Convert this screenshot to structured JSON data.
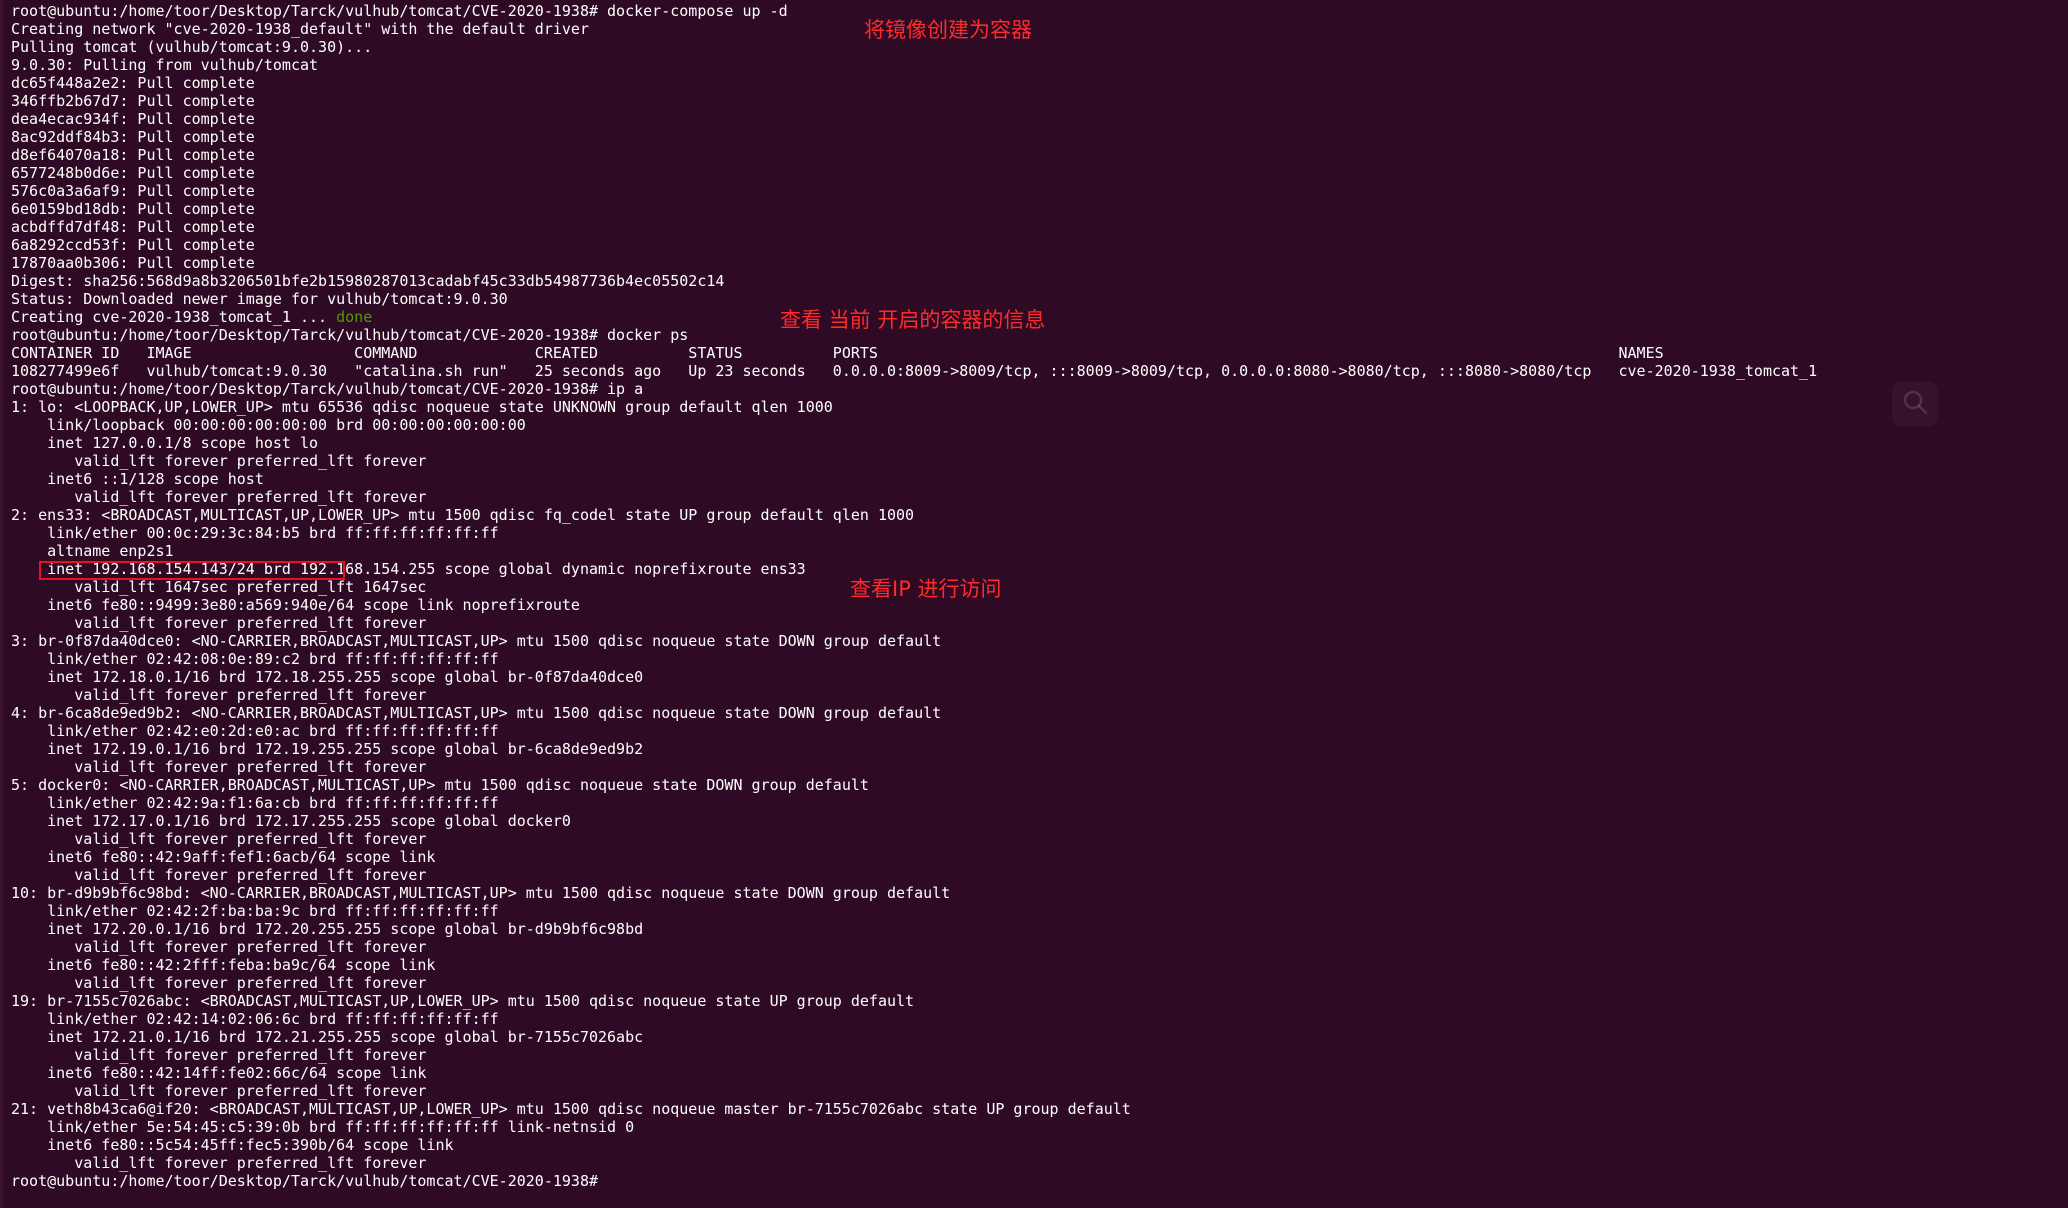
{
  "terminal": {
    "lines": [
      "root@ubuntu:/home/toor/Desktop/Tarck/vulhub/tomcat/CVE-2020-1938# docker-compose up -d",
      "Creating network \"cve-2020-1938_default\" with the default driver",
      "Pulling tomcat (vulhub/tomcat:9.0.30)...",
      "9.0.30: Pulling from vulhub/tomcat",
      "dc65f448a2e2: Pull complete",
      "346ffb2b67d7: Pull complete",
      "dea4ecac934f: Pull complete",
      "8ac92ddf84b3: Pull complete",
      "d8ef64070a18: Pull complete",
      "6577248b0d6e: Pull complete",
      "576c0a3a6af9: Pull complete",
      "6e0159bd18db: Pull complete",
      "acbdffd7df48: Pull complete",
      "6a8292ccd53f: Pull complete",
      "17870aa0b306: Pull complete",
      "Digest: sha256:568d9a8b3206501bfe2b15980287013cadabf45c33db54987736b4ec05502c14",
      "Status: Downloaded newer image for vulhub/tomcat:9.0.30",
      "Creating cve-2020-1938_tomcat_1 ... ",
      "root@ubuntu:/home/toor/Desktop/Tarck/vulhub/tomcat/CVE-2020-1938# docker ps",
      "CONTAINER ID   IMAGE                  COMMAND             CREATED          STATUS          PORTS                                                                                  NAMES",
      "108277499e6f   vulhub/tomcat:9.0.30   \"catalina.sh run\"   25 seconds ago   Up 23 seconds   0.0.0.0:8009->8009/tcp, :::8009->8009/tcp, 0.0.0.0:8080->8080/tcp, :::8080->8080/tcp   cve-2020-1938_tomcat_1",
      "root@ubuntu:/home/toor/Desktop/Tarck/vulhub/tomcat/CVE-2020-1938# ip a",
      "1: lo: <LOOPBACK,UP,LOWER_UP> mtu 65536 qdisc noqueue state UNKNOWN group default qlen 1000",
      "    link/loopback 00:00:00:00:00:00 brd 00:00:00:00:00:00",
      "    inet 127.0.0.1/8 scope host lo",
      "       valid_lft forever preferred_lft forever",
      "    inet6 ::1/128 scope host",
      "       valid_lft forever preferred_lft forever",
      "2: ens33: <BROADCAST,MULTICAST,UP,LOWER_UP> mtu 1500 qdisc fq_codel state UP group default qlen 1000",
      "    link/ether 00:0c:29:3c:84:b5 brd ff:ff:ff:ff:ff:ff",
      "    altname enp2s1",
      "    inet 192.168.154.143/24 brd 192.168.154.255 scope global dynamic noprefixroute ens33",
      "       valid_lft 1647sec preferred_lft 1647sec",
      "    inet6 fe80::9499:3e80:a569:940e/64 scope link noprefixroute",
      "       valid_lft forever preferred_lft forever",
      "3: br-0f87da40dce0: <NO-CARRIER,BROADCAST,MULTICAST,UP> mtu 1500 qdisc noqueue state DOWN group default",
      "    link/ether 02:42:08:0e:89:c2 brd ff:ff:ff:ff:ff:ff",
      "    inet 172.18.0.1/16 brd 172.18.255.255 scope global br-0f87da40dce0",
      "       valid_lft forever preferred_lft forever",
      "4: br-6ca8de9ed9b2: <NO-CARRIER,BROADCAST,MULTICAST,UP> mtu 1500 qdisc noqueue state DOWN group default",
      "    link/ether 02:42:e0:2d:e0:ac brd ff:ff:ff:ff:ff:ff",
      "    inet 172.19.0.1/16 brd 172.19.255.255 scope global br-6ca8de9ed9b2",
      "       valid_lft forever preferred_lft forever",
      "5: docker0: <NO-CARRIER,BROADCAST,MULTICAST,UP> mtu 1500 qdisc noqueue state DOWN group default",
      "    link/ether 02:42:9a:f1:6a:cb brd ff:ff:ff:ff:ff:ff",
      "    inet 172.17.0.1/16 brd 172.17.255.255 scope global docker0",
      "       valid_lft forever preferred_lft forever",
      "    inet6 fe80::42:9aff:fef1:6acb/64 scope link",
      "       valid_lft forever preferred_lft forever",
      "10: br-d9b9bf6c98bd: <NO-CARRIER,BROADCAST,MULTICAST,UP> mtu 1500 qdisc noqueue state DOWN group default",
      "    link/ether 02:42:2f:ba:ba:9c brd ff:ff:ff:ff:ff:ff",
      "    inet 172.20.0.1/16 brd 172.20.255.255 scope global br-d9b9bf6c98bd",
      "       valid_lft forever preferred_lft forever",
      "    inet6 fe80::42:2fff:feba:ba9c/64 scope link",
      "       valid_lft forever preferred_lft forever",
      "19: br-7155c7026abc: <BROADCAST,MULTICAST,UP,LOWER_UP> mtu 1500 qdisc noqueue state UP group default",
      "    link/ether 02:42:14:02:06:6c brd ff:ff:ff:ff:ff:ff",
      "    inet 172.21.0.1/16 brd 172.21.255.255 scope global br-7155c7026abc",
      "       valid_lft forever preferred_lft forever",
      "    inet6 fe80::42:14ff:fe02:66c/64 scope link",
      "       valid_lft forever preferred_lft forever",
      "21: veth8b43ca6@if20: <BROADCAST,MULTICAST,UP,LOWER_UP> mtu 1500 qdisc noqueue master br-7155c7026abc state UP group default",
      "    link/ether 5e:54:45:c5:39:0b brd ff:ff:ff:ff:ff:ff link-netnsid 0",
      "    inet6 fe80::5c54:45ff:fec5:390b/64 scope link",
      "       valid_lft forever preferred_lft forever",
      "root@ubuntu:/home/toor/Desktop/Tarck/vulhub/tomcat/CVE-2020-1938# "
    ],
    "done_word": "done",
    "done_line_index": 17,
    "prompt_line_index": 66
  },
  "annotations": {
    "create_container": "将镜像创建为容器",
    "view_containers": "查看 当前 开启的容器的信息",
    "view_ip": "查看IP 进行访问"
  },
  "colors": {
    "background": "#2f0a24",
    "text": "#ffffff",
    "done": "#4e9a06",
    "annotation": "#ff2a2a",
    "highlight_box": "#e8121e"
  },
  "icons": {
    "search": "search-icon"
  }
}
